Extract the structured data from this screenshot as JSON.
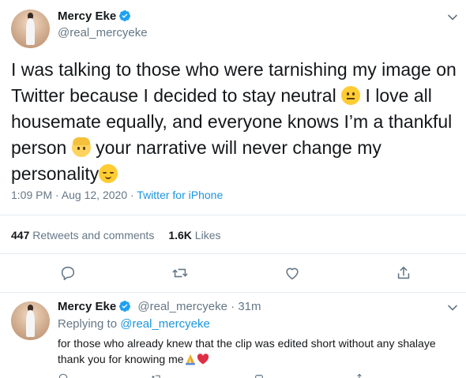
{
  "main_tweet": {
    "name": "Mercy Eke",
    "handle": "@real_mercyeke",
    "text_1": "I was talking to those who were tarnishing my image on Twitter because I decided to stay neutral ",
    "text_2": " I love all housemate equally, and everyone knows I’m a thankful person ",
    "text_3": " your narrative will never change my personality",
    "emoji_1": "neutral-face",
    "emoji_2": "blond-person",
    "emoji_3": "relieved-face",
    "time": "1:09 PM · Aug 12, 2020 · ",
    "source": "Twitter for iPhone",
    "retweets_count": "447",
    "retweets_label": "Retweets and comments",
    "likes_count": "1.6K",
    "likes_label": "Likes"
  },
  "actions": {
    "reply_icon": "reply-icon",
    "retweet_icon": "retweet-icon",
    "like_icon": "heart-icon",
    "share_icon": "share-icon"
  },
  "reply_tweet": {
    "name": "Mercy Eke",
    "handle_time": "@real_mercyeke · 31m",
    "replying_prefix": "Replying to ",
    "replying_handle": "@real_mercyeke",
    "text": "for those who already knew that the clip was edited short without any shalaye thank you for knowing me",
    "emoji_1": "folded-hands",
    "emoji_2": "red-heart"
  },
  "colors": {
    "accent": "#1b95e0",
    "verified": "#1da1f2",
    "muted": "#657786",
    "text": "#14171a",
    "divider": "#e6ecf0"
  }
}
